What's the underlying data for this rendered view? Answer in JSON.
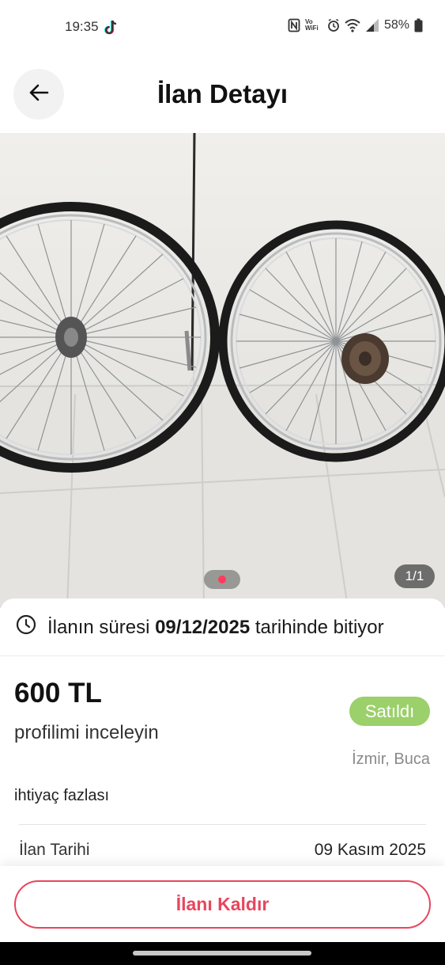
{
  "status_bar": {
    "time": "19:35",
    "vowifi_top": "Vo",
    "vowifi_bottom": "WiFi",
    "battery": "58%",
    "icons": [
      "tiktok-icon",
      "nfc-icon",
      "vowifi-icon",
      "alarm-icon",
      "wifi-icon",
      "signal-icon",
      "battery-icon"
    ]
  },
  "header": {
    "back_icon": "arrow-left-icon",
    "title": "İlan Detayı"
  },
  "gallery": {
    "counter": "1/1",
    "image_subject": "two bicycle wheels",
    "active_dot_color": "#ff3b5c"
  },
  "listing": {
    "expiry_prefix": "İlanın süresi",
    "expiry_date": "09/12/2025",
    "expiry_suffix": "tarihinde bitiyor",
    "price": "600 TL",
    "status": "Satıldı",
    "status_color": "#9bd06a",
    "subtitle": "profilimi inceleyin",
    "location": "İzmir, Buca",
    "description": "ihtiyaç fazlası",
    "date_label": "İlan Tarihi",
    "date_value": "09 Kasım 2025"
  },
  "actions": {
    "remove_label": "İlanı Kaldır",
    "accent_color": "#e8465e"
  }
}
